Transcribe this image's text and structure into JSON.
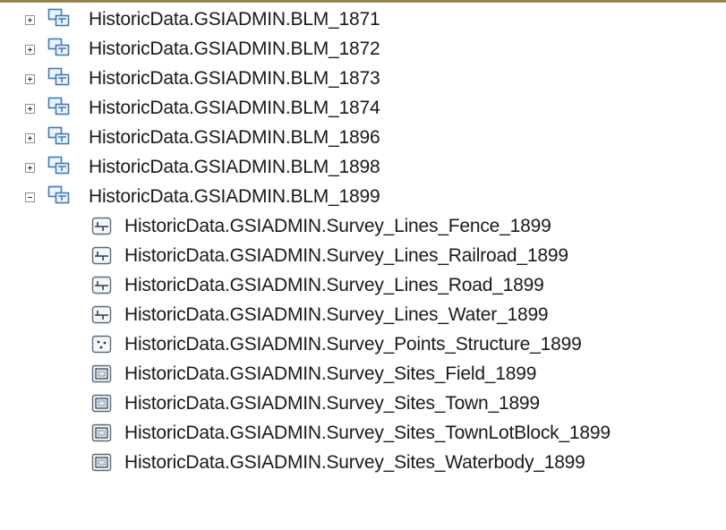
{
  "accent_color": "#9c8650",
  "datasets": [
    {
      "label": "HistoricData.GSIADMIN.BLM_1871",
      "expanded": false,
      "icon": "feature-dataset-icon"
    },
    {
      "label": "HistoricData.GSIADMIN.BLM_1872",
      "expanded": false,
      "icon": "feature-dataset-icon"
    },
    {
      "label": "HistoricData.GSIADMIN.BLM_1873",
      "expanded": false,
      "icon": "feature-dataset-icon"
    },
    {
      "label": "HistoricData.GSIADMIN.BLM_1874",
      "expanded": false,
      "icon": "feature-dataset-icon"
    },
    {
      "label": "HistoricData.GSIADMIN.BLM_1896",
      "expanded": false,
      "icon": "feature-dataset-icon"
    },
    {
      "label": "HistoricData.GSIADMIN.BLM_1898",
      "expanded": false,
      "icon": "feature-dataset-icon"
    },
    {
      "label": "HistoricData.GSIADMIN.BLM_1899",
      "expanded": true,
      "icon": "feature-dataset-icon"
    }
  ],
  "children": [
    {
      "label": "HistoricData.GSIADMIN.Survey_Lines_Fence_1899",
      "icon": "line-feature-class-icon"
    },
    {
      "label": "HistoricData.GSIADMIN.Survey_Lines_Railroad_1899",
      "icon": "line-feature-class-icon"
    },
    {
      "label": "HistoricData.GSIADMIN.Survey_Lines_Road_1899",
      "icon": "line-feature-class-icon"
    },
    {
      "label": "HistoricData.GSIADMIN.Survey_Lines_Water_1899",
      "icon": "line-feature-class-icon"
    },
    {
      "label": "HistoricData.GSIADMIN.Survey_Points_Structure_1899",
      "icon": "point-feature-class-icon"
    },
    {
      "label": "HistoricData.GSIADMIN.Survey_Sites_Field_1899",
      "icon": "polygon-feature-class-icon"
    },
    {
      "label": "HistoricData.GSIADMIN.Survey_Sites_Town_1899",
      "icon": "polygon-feature-class-icon"
    },
    {
      "label": "HistoricData.GSIADMIN.Survey_Sites_TownLotBlock_1899",
      "icon": "polygon-feature-class-icon"
    },
    {
      "label": "HistoricData.GSIADMIN.Survey_Sites_Waterbody_1899",
      "icon": "polygon-feature-class-icon"
    }
  ]
}
